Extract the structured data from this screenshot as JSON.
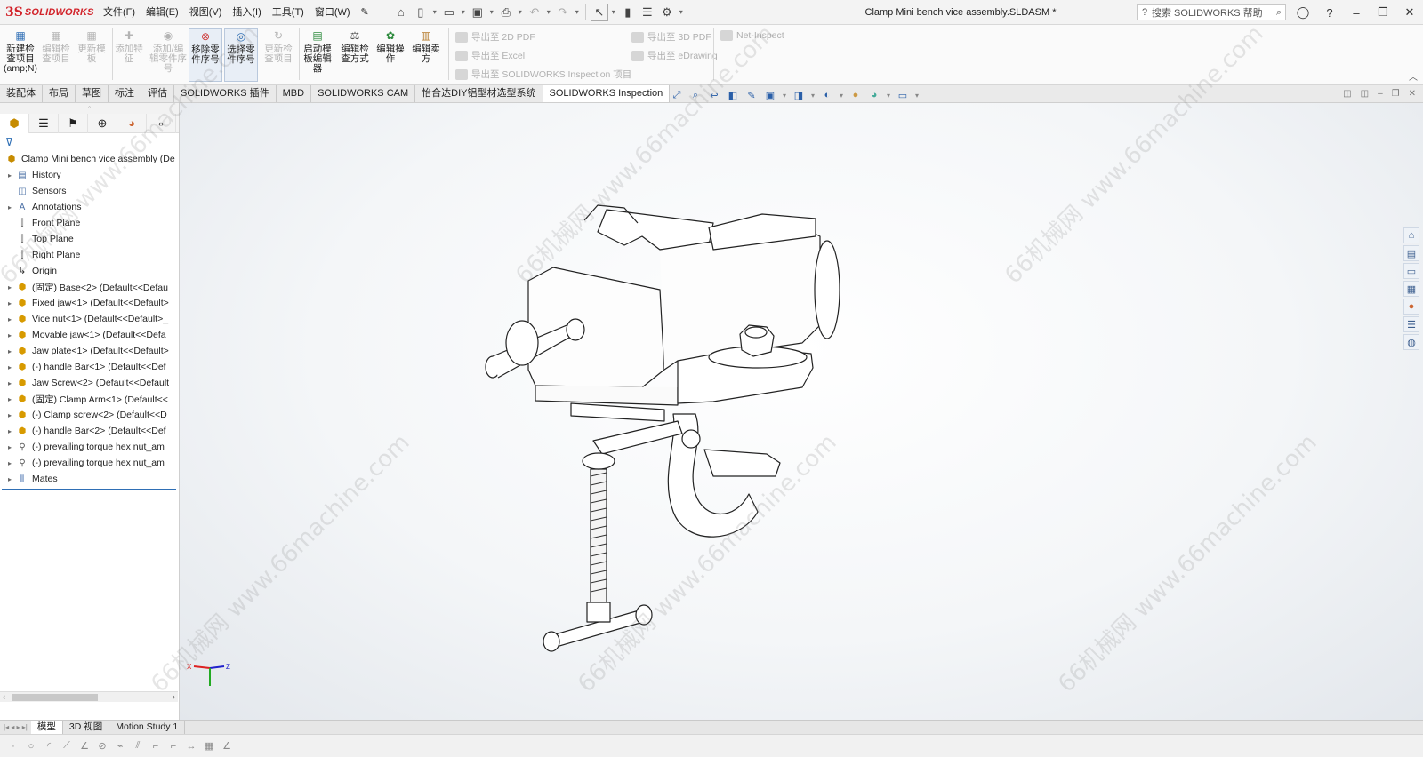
{
  "app": {
    "logo_mark": "3S",
    "logo_text": "SOLIDWORKS",
    "doc_title": "Clamp Mini bench vice assembly.SLDASM *"
  },
  "menu": [
    "文件(F)",
    "编辑(E)",
    "视图(V)",
    "插入(I)",
    "工具(T)",
    "窗口(W)"
  ],
  "search": {
    "placeholder": "搜索 SOLIDWORKS 帮助"
  },
  "ribbon": {
    "buttons": [
      {
        "label": "新建检查项目\n(amp;N)",
        "state": "on"
      },
      {
        "label": "编辑检查项目",
        "state": "off"
      },
      {
        "label": "更新模板",
        "state": "off"
      },
      {
        "label": "添加特征",
        "state": "off"
      },
      {
        "label": "添加/编辑零件序号",
        "state": "off"
      },
      {
        "label": "移除零件序号",
        "state": "sel"
      },
      {
        "label": "选择零件序号",
        "state": "sel"
      },
      {
        "label": "更新检查项目",
        "state": "off"
      },
      {
        "label": "启动模板编辑器",
        "state": "on"
      },
      {
        "label": "编辑检查方式",
        "state": "on"
      },
      {
        "label": "编辑操作",
        "state": "on"
      },
      {
        "label": "编辑卖方",
        "state": "on"
      }
    ],
    "export_2d_pdf": "导出至 2D PDF",
    "export_excel": "导出至 Excel",
    "export_inspection": "导出至 SOLIDWORKS Inspection 项目",
    "export_3d_pdf": "导出至 3D PDF",
    "export_edrawing": "导出至 eDrawing",
    "net_inspect": "Net-Inspect"
  },
  "tabs": [
    "装配体",
    "布局",
    "草图",
    "标注",
    "评估",
    "SOLIDWORKS 插件",
    "MBD",
    "SOLIDWORKS CAM",
    "怡合达DIY铝型材选型系统",
    "SOLIDWORKS Inspection"
  ],
  "active_tab": "SOLIDWORKS Inspection",
  "tree": {
    "root": "Clamp Mini bench vice assembly  (De",
    "items": [
      {
        "label": "History",
        "icon": "history-icon",
        "expand": true
      },
      {
        "label": "Sensors",
        "icon": "sensors-icon",
        "expand": false
      },
      {
        "label": "Annotations",
        "icon": "annotations-icon",
        "expand": true
      },
      {
        "label": "Front Plane",
        "icon": "plane-icon",
        "expand": false
      },
      {
        "label": "Top Plane",
        "icon": "plane-icon",
        "expand": false
      },
      {
        "label": "Right Plane",
        "icon": "plane-icon",
        "expand": false
      },
      {
        "label": "Origin",
        "icon": "origin-icon",
        "expand": false
      },
      {
        "label": "(固定) Base<2> (Default<<Defau",
        "icon": "part-icon",
        "expand": true
      },
      {
        "label": "Fixed jaw<1> (Default<<Default>",
        "icon": "part-icon",
        "expand": true
      },
      {
        "label": "Vice nut<1> (Default<<Default>_",
        "icon": "part-icon",
        "expand": true
      },
      {
        "label": "Movable jaw<1> (Default<<Defa",
        "icon": "part-icon",
        "expand": true
      },
      {
        "label": "Jaw plate<1> (Default<<Default>",
        "icon": "part-icon",
        "expand": true
      },
      {
        "label": "(-) handle Bar<1> (Default<<Def",
        "icon": "part-icon",
        "expand": true
      },
      {
        "label": "Jaw Screw<2> (Default<<Default",
        "icon": "part-icon",
        "expand": true
      },
      {
        "label": "(固定) Clamp Arm<1> (Default<<",
        "icon": "part-icon",
        "expand": true
      },
      {
        "label": "(-) Clamp screw<2> (Default<<D",
        "icon": "part-icon",
        "expand": true
      },
      {
        "label": "(-) handle Bar<2> (Default<<Def",
        "icon": "part-icon",
        "expand": true
      },
      {
        "label": "(-) prevailing torque hex nut_am",
        "icon": "bolt-icon",
        "expand": true
      },
      {
        "label": "(-) prevailing torque hex nut_am",
        "icon": "bolt-icon",
        "expand": true
      },
      {
        "label": "Mates",
        "icon": "mates-icon",
        "expand": true
      }
    ]
  },
  "bottom_tabs": [
    "模型",
    "3D 视图",
    "Motion Study 1"
  ],
  "active_bottom_tab": "模型",
  "triad": {
    "x": "X",
    "z": "Z"
  },
  "watermark": "66机械网 www.66machine.com",
  "colors": {
    "brand": "#d2232a",
    "accent": "#2f6fb5"
  }
}
